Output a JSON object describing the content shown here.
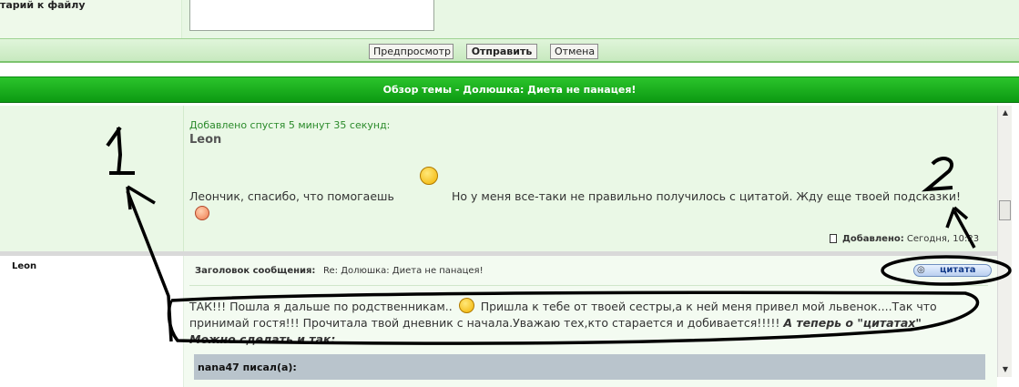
{
  "form": {
    "attachment_comment_label": "тарий к файлу"
  },
  "buttons": {
    "preview": "Предпросмотр",
    "submit": "Отправить",
    "cancel": "Отмена"
  },
  "topic_bar": {
    "title": "Обзор темы - Долюшка: Диета не панацея!"
  },
  "post1": {
    "added_after": "Добавлено спустя 5 минут 35 секунд:",
    "author": "Leon",
    "text_part1": "Леончик, спасибо, что помогаешь",
    "text_part2": "Но у меня все-таки не правильно получилось с цитатой. Жду еще твоей подсказки!",
    "posted_label": "Добавлено:",
    "posted_value": "Сегодня, 10:23"
  },
  "post2": {
    "author": "Leon",
    "subject_label": "Заголовок сообщения:",
    "subject_value": "Re: Долюшка: Диета не панацея!",
    "quote_button": "цитата",
    "text_part1": "ТАК!!! Пошла я дальше по родственникам..",
    "text_part2": "Пришла к тебе от твоей сестры,а к ней меня привел мой львенок....Так что принимай гостя!!! Прочитала твой дневник с начала.Уважаю тех,кто старается и добивается!!!!!",
    "text_emphasis_1": "А теперь о \"цитатах\"",
    "text_emphasis_2": "Можно сделать и так:",
    "quote_header": "nana47 писал(а):"
  },
  "annotations": {
    "mark1": "1",
    "mark2": "2"
  },
  "colors": {
    "topic_bar": "#10a516",
    "post_bg": "#eaf8e6",
    "quote_bg": "#b9c4cc"
  }
}
